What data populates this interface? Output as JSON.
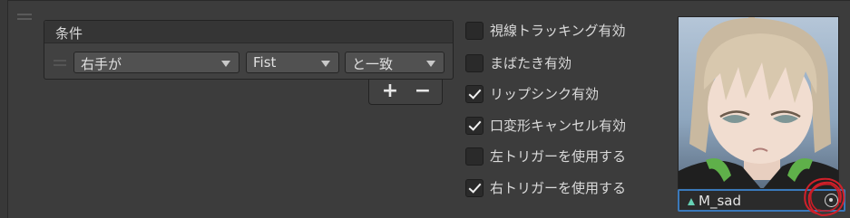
{
  "conditions": {
    "title": "条件",
    "row": {
      "hand": "右手が",
      "gesture": "Fist",
      "match": "と一致"
    },
    "add_symbol": "+",
    "remove_symbol": "−"
  },
  "toggles": [
    {
      "label": "視線トラッキング有効",
      "checked": false
    },
    {
      "label": "まばたき有効",
      "checked": false
    },
    {
      "label": "リップシンク有効",
      "checked": true
    },
    {
      "label": "口変形キャンセル有効",
      "checked": true
    },
    {
      "label": "左トリガーを使用する",
      "checked": false
    },
    {
      "label": "右トリガーを使用する",
      "checked": true
    }
  ],
  "animation_field": {
    "value": "M_sad",
    "icon": "animation-clip-icon",
    "picker_icon": "object-picker-icon"
  },
  "colors": {
    "selection_border": "#3a79bb",
    "annotation_red": "#d0202a"
  }
}
